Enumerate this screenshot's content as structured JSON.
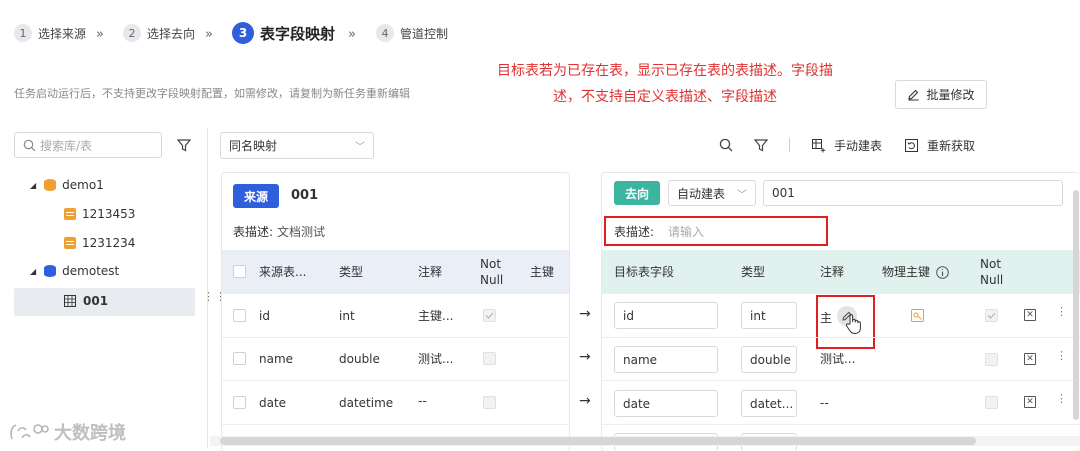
{
  "steps": [
    {
      "num": "1",
      "label": "选择来源"
    },
    {
      "num": "2",
      "label": "选择去向"
    },
    {
      "num": "3",
      "label": "表字段映射"
    },
    {
      "num": "4",
      "label": "管道控制"
    }
  ],
  "step_separator": "»",
  "hint": "任务启动运行后，不支持更改字段映射配置，如需修改，请复制为新任务重新编辑",
  "annotation": {
    "line1": "目标表若为已存在表，显示已存在表的表描述。字段描",
    "line2": "述，不支持自定义表描述、字段描述"
  },
  "batch_edit_label": "批量修改",
  "left_panel": {
    "search_placeholder": "搜索库/表",
    "tree": [
      {
        "label": "demo1",
        "children": [
          "1213453",
          "1231234"
        ]
      },
      {
        "label": "demotest",
        "children": [
          "001"
        ]
      }
    ]
  },
  "mapping_select": "同名映射",
  "toolbar": {
    "manual_create": "手动建表",
    "refetch": "重新获取"
  },
  "source": {
    "tag": "来源",
    "table_name": "001",
    "desc_label": "表描述:",
    "desc_value": "文档测试",
    "headers": [
      "来源表...",
      "类型",
      "注释",
      "Not Null",
      "主键"
    ],
    "rows": [
      {
        "field": "id",
        "type": "int",
        "comment": "主键...",
        "not_null": true
      },
      {
        "field": "name",
        "type": "double",
        "comment": "测试...",
        "not_null": false
      },
      {
        "field": "date",
        "type": "datetime",
        "comment": "--",
        "not_null": false
      }
    ]
  },
  "target": {
    "tag": "去向",
    "create_mode": "自动建表",
    "table_name": "001",
    "desc_label": "表描述:",
    "desc_placeholder": "请输入",
    "headers": [
      "目标表字段",
      "类型",
      "注释",
      "物理主键",
      "Not Null"
    ],
    "rows": [
      {
        "field": "id",
        "type": "int",
        "comment": "主",
        "pk": true,
        "not_null": true
      },
      {
        "field": "name",
        "type": "double",
        "comment": "测试...",
        "pk": false,
        "not_null": false
      },
      {
        "field": "date",
        "type": "datet...",
        "comment": "--",
        "pk": false,
        "not_null": false
      }
    ]
  },
  "watermark": "大数跨境",
  "colors": {
    "accent": "#2f5fdd",
    "target_tag": "#3bb5a0",
    "highlight": "#e02020",
    "annotation": "#e03030"
  }
}
